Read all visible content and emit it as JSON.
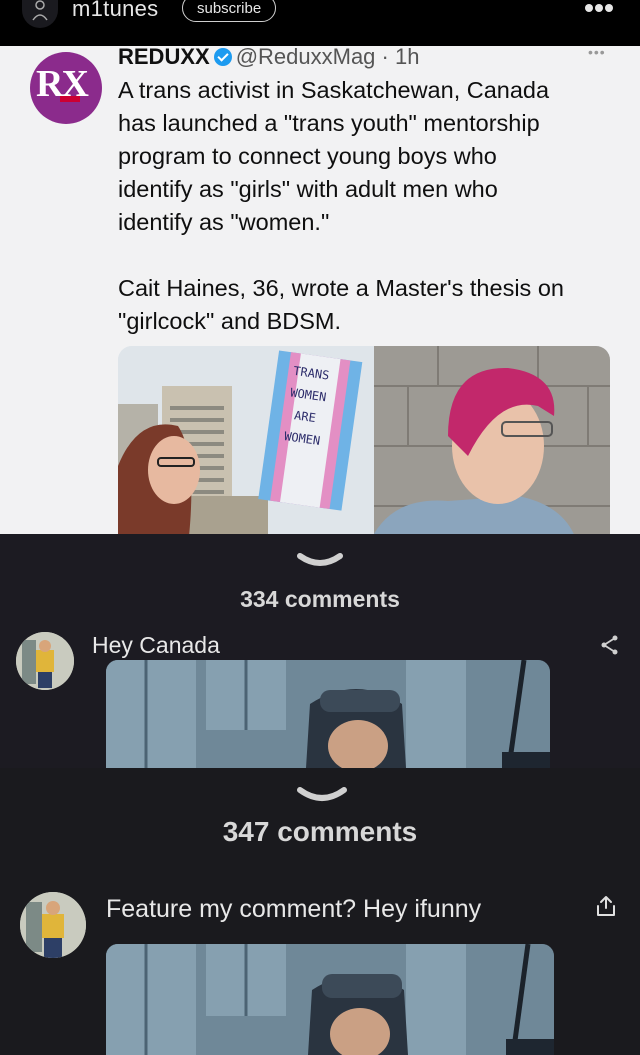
{
  "header": {
    "username": "m1tunes",
    "subscribe_label": "subscribe",
    "icons": {
      "user": "user-icon",
      "more": "more-dots-icon"
    }
  },
  "tweet": {
    "avatar_text": "RX",
    "display_name": "REDUXX",
    "handle_time": "@ReduxxMag · 1h",
    "paragraph1": "A trans activist in Saskatchewan, Canada\nhas launched a \"trans youth\" mentorship\nprogram to connect young boys who\nidentify as \"girls\" with adult men who\nidentify as \"women.\"",
    "paragraph2": "Cait Haines, 36, wrote a Master's thesis on\n\"girlcock\" and BDSM.",
    "sign_text": "TRANS WOMEN ARE WOMEN"
  },
  "threads": [
    {
      "comments_label": "334 comments",
      "comment_text": "Hey Canada",
      "icons": {
        "toggle": "chevron-down-icon",
        "share": "share-icon"
      }
    },
    {
      "comments_label": "347 comments",
      "comment_text": "Feature my comment? Hey ifunny",
      "icons": {
        "toggle": "chevron-down-icon",
        "share": "share-icon"
      }
    }
  ],
  "colors": {
    "background": "#1c1b22",
    "topbar": "#000000",
    "tweet_bg": "#f2f2f3",
    "verified": "#1d9bf0",
    "reduxx_purple": "#8b2b8c"
  }
}
